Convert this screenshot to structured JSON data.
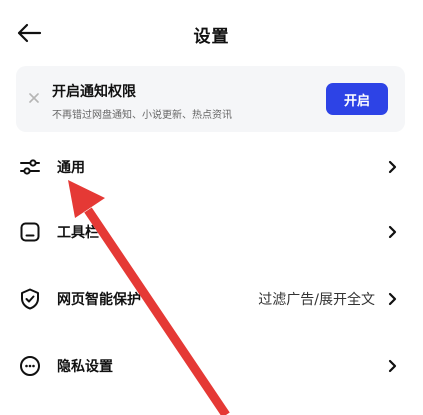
{
  "header": {
    "title": "设置",
    "back_icon": "arrow-left-icon"
  },
  "notification_card": {
    "close_icon": "close-icon",
    "title": "开启通知权限",
    "subtitle": "不再错过网盘通知、小说更新、热点资讯",
    "button_label": "开启",
    "button_color": "#2d43e6"
  },
  "settings": {
    "items": [
      {
        "label": "通用",
        "icon": "sliders-icon",
        "value": ""
      },
      {
        "label": "工具栏",
        "icon": "toolbar-square-icon",
        "value": ""
      },
      {
        "label": "网页智能保护",
        "icon": "shield-check-icon",
        "value": "过滤广告/展开全文"
      },
      {
        "label": "隐私设置",
        "icon": "privacy-face-icon",
        "value": ""
      }
    ],
    "chevron_icon": "chevron-right-icon"
  },
  "annotation": {
    "type": "arrow",
    "color": "#e53935",
    "points_to": "通用"
  }
}
